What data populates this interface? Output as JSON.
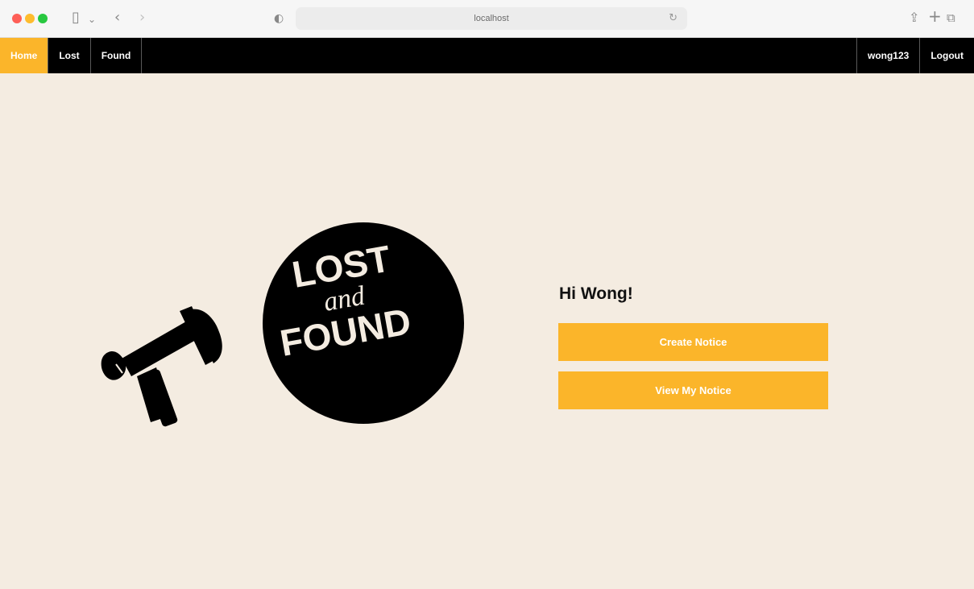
{
  "browser": {
    "address": "localhost",
    "icons": {
      "sidebar": "sidebar-icon",
      "back": "chevron-left-icon",
      "forward": "chevron-right-icon",
      "privacy": "privacy-shield-icon",
      "reload": "reload-icon",
      "share": "share-icon",
      "new_tab": "plus-icon",
      "tabs": "tabs-icon"
    }
  },
  "nav": {
    "home": "Home",
    "lost": "Lost",
    "found": "Found",
    "username": "wong123",
    "logout": "Logout"
  },
  "hero": {
    "logo_top": "LOST",
    "logo_middle": "and",
    "logo_bottom": "FOUND"
  },
  "content": {
    "greeting": "Hi Wong!",
    "create_notice": "Create Notice",
    "view_notice": "View My Notice"
  },
  "colors": {
    "accent": "#fbb52a",
    "navbar": "#000000",
    "page_background": "#f4ece1"
  }
}
